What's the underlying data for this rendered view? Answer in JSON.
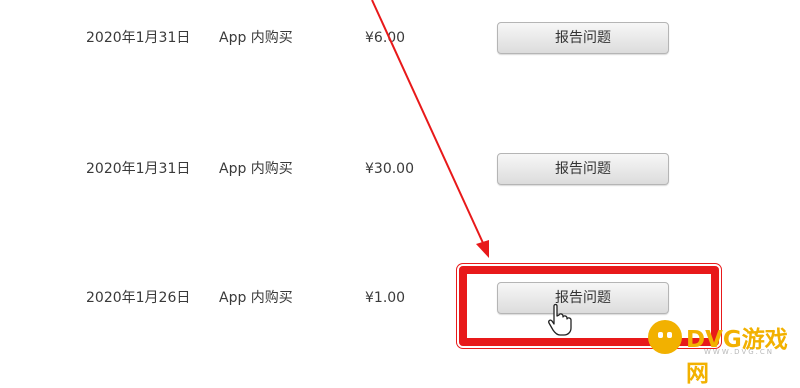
{
  "purchases": [
    {
      "date": "2020年1月31日",
      "type": "App 内购买",
      "price": "¥6.00",
      "action": "报告问题"
    },
    {
      "date": "2020年1月31日",
      "type": "App 内购买",
      "price": "¥30.00",
      "action": "报告问题"
    },
    {
      "date": "2020年1月26日",
      "type": "App 内购买",
      "price": "¥1.00",
      "action": "报告问题"
    }
  ],
  "annotation": {
    "color": "#e8191a"
  },
  "watermark": {
    "text": "DVG游戏网",
    "subtext": "WWW.DVG.CN",
    "color": "#f2b100"
  }
}
